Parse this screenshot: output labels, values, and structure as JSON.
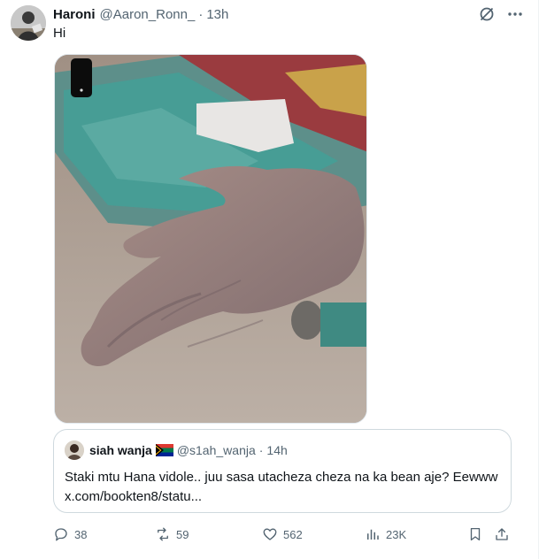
{
  "tweet": {
    "author_name": "Haroni",
    "handle": "@Aaron_Ronn_",
    "separator": "·",
    "time": "13h",
    "text": "Hi",
    "top_icons": [
      "grok-icon",
      "more-icon"
    ]
  },
  "quote": {
    "author_name": "siah wanja",
    "flag": "south-africa-flag-icon",
    "handle": "@s1ah_wanja",
    "separator": "·",
    "time": "14h",
    "text": "Staki mtu Hana vidole.. juu sasa utacheza cheza na ka bean aje? Eewww x.com/bookten8/statu..."
  },
  "actions": {
    "replies": "38",
    "reposts": "59",
    "likes": "562",
    "views": "23K"
  },
  "colors": {
    "text": "#0f1419",
    "muted": "#536471",
    "border": "#cfd9de"
  }
}
